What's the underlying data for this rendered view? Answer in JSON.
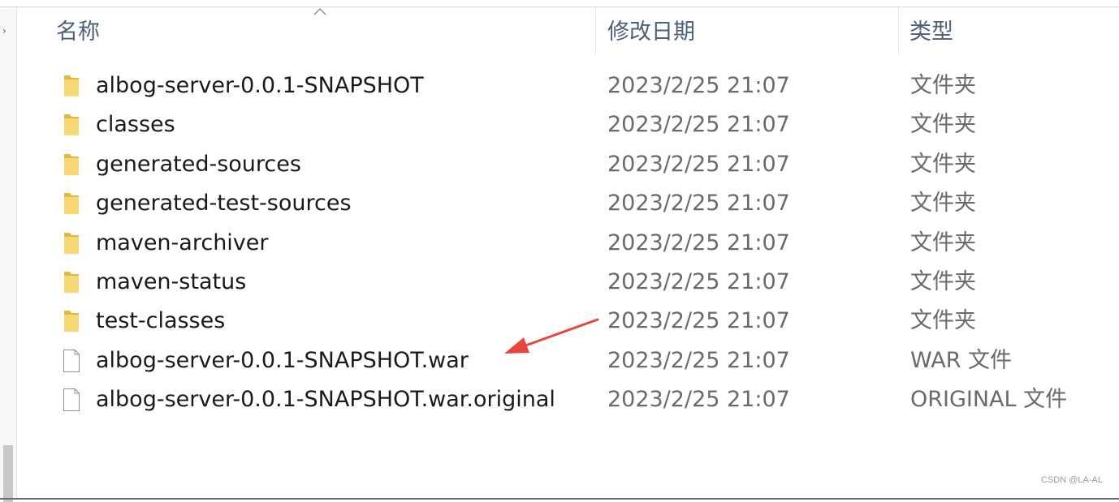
{
  "columns": {
    "name": "名称",
    "date": "修改日期",
    "type": "类型"
  },
  "files": [
    {
      "name": "albog-server-0.0.1-SNAPSHOT",
      "date": "2023/2/25 21:07",
      "type": "文件夹",
      "icon": "folder-icon"
    },
    {
      "name": "classes",
      "date": "2023/2/25 21:07",
      "type": "文件夹",
      "icon": "folder-icon"
    },
    {
      "name": "generated-sources",
      "date": "2023/2/25 21:07",
      "type": "文件夹",
      "icon": "folder-icon"
    },
    {
      "name": "generated-test-sources",
      "date": "2023/2/25 21:07",
      "type": "文件夹",
      "icon": "folder-icon"
    },
    {
      "name": "maven-archiver",
      "date": "2023/2/25 21:07",
      "type": "文件夹",
      "icon": "folder-icon"
    },
    {
      "name": "maven-status",
      "date": "2023/2/25 21:07",
      "type": "文件夹",
      "icon": "folder-icon"
    },
    {
      "name": "test-classes",
      "date": "2023/2/25 21:07",
      "type": "文件夹",
      "icon": "folder-icon"
    },
    {
      "name": "albog-server-0.0.1-SNAPSHOT.war",
      "date": "2023/2/25 21:07",
      "type": "WAR 文件",
      "icon": "file-icon"
    },
    {
      "name": "albog-server-0.0.1-SNAPSHOT.war.original",
      "date": "2023/2/25 21:07",
      "type": "ORIGINAL 文件",
      "icon": "file-icon"
    }
  ],
  "annotation": {
    "arrow_color": "#e8453c",
    "arrow_icon": "red-arrow-icon"
  },
  "colors": {
    "folder_yellow": "#f8d775",
    "folder_dark": "#e6b73e",
    "header_text": "#4c607a"
  },
  "watermark": "CSDN @LA-AL"
}
